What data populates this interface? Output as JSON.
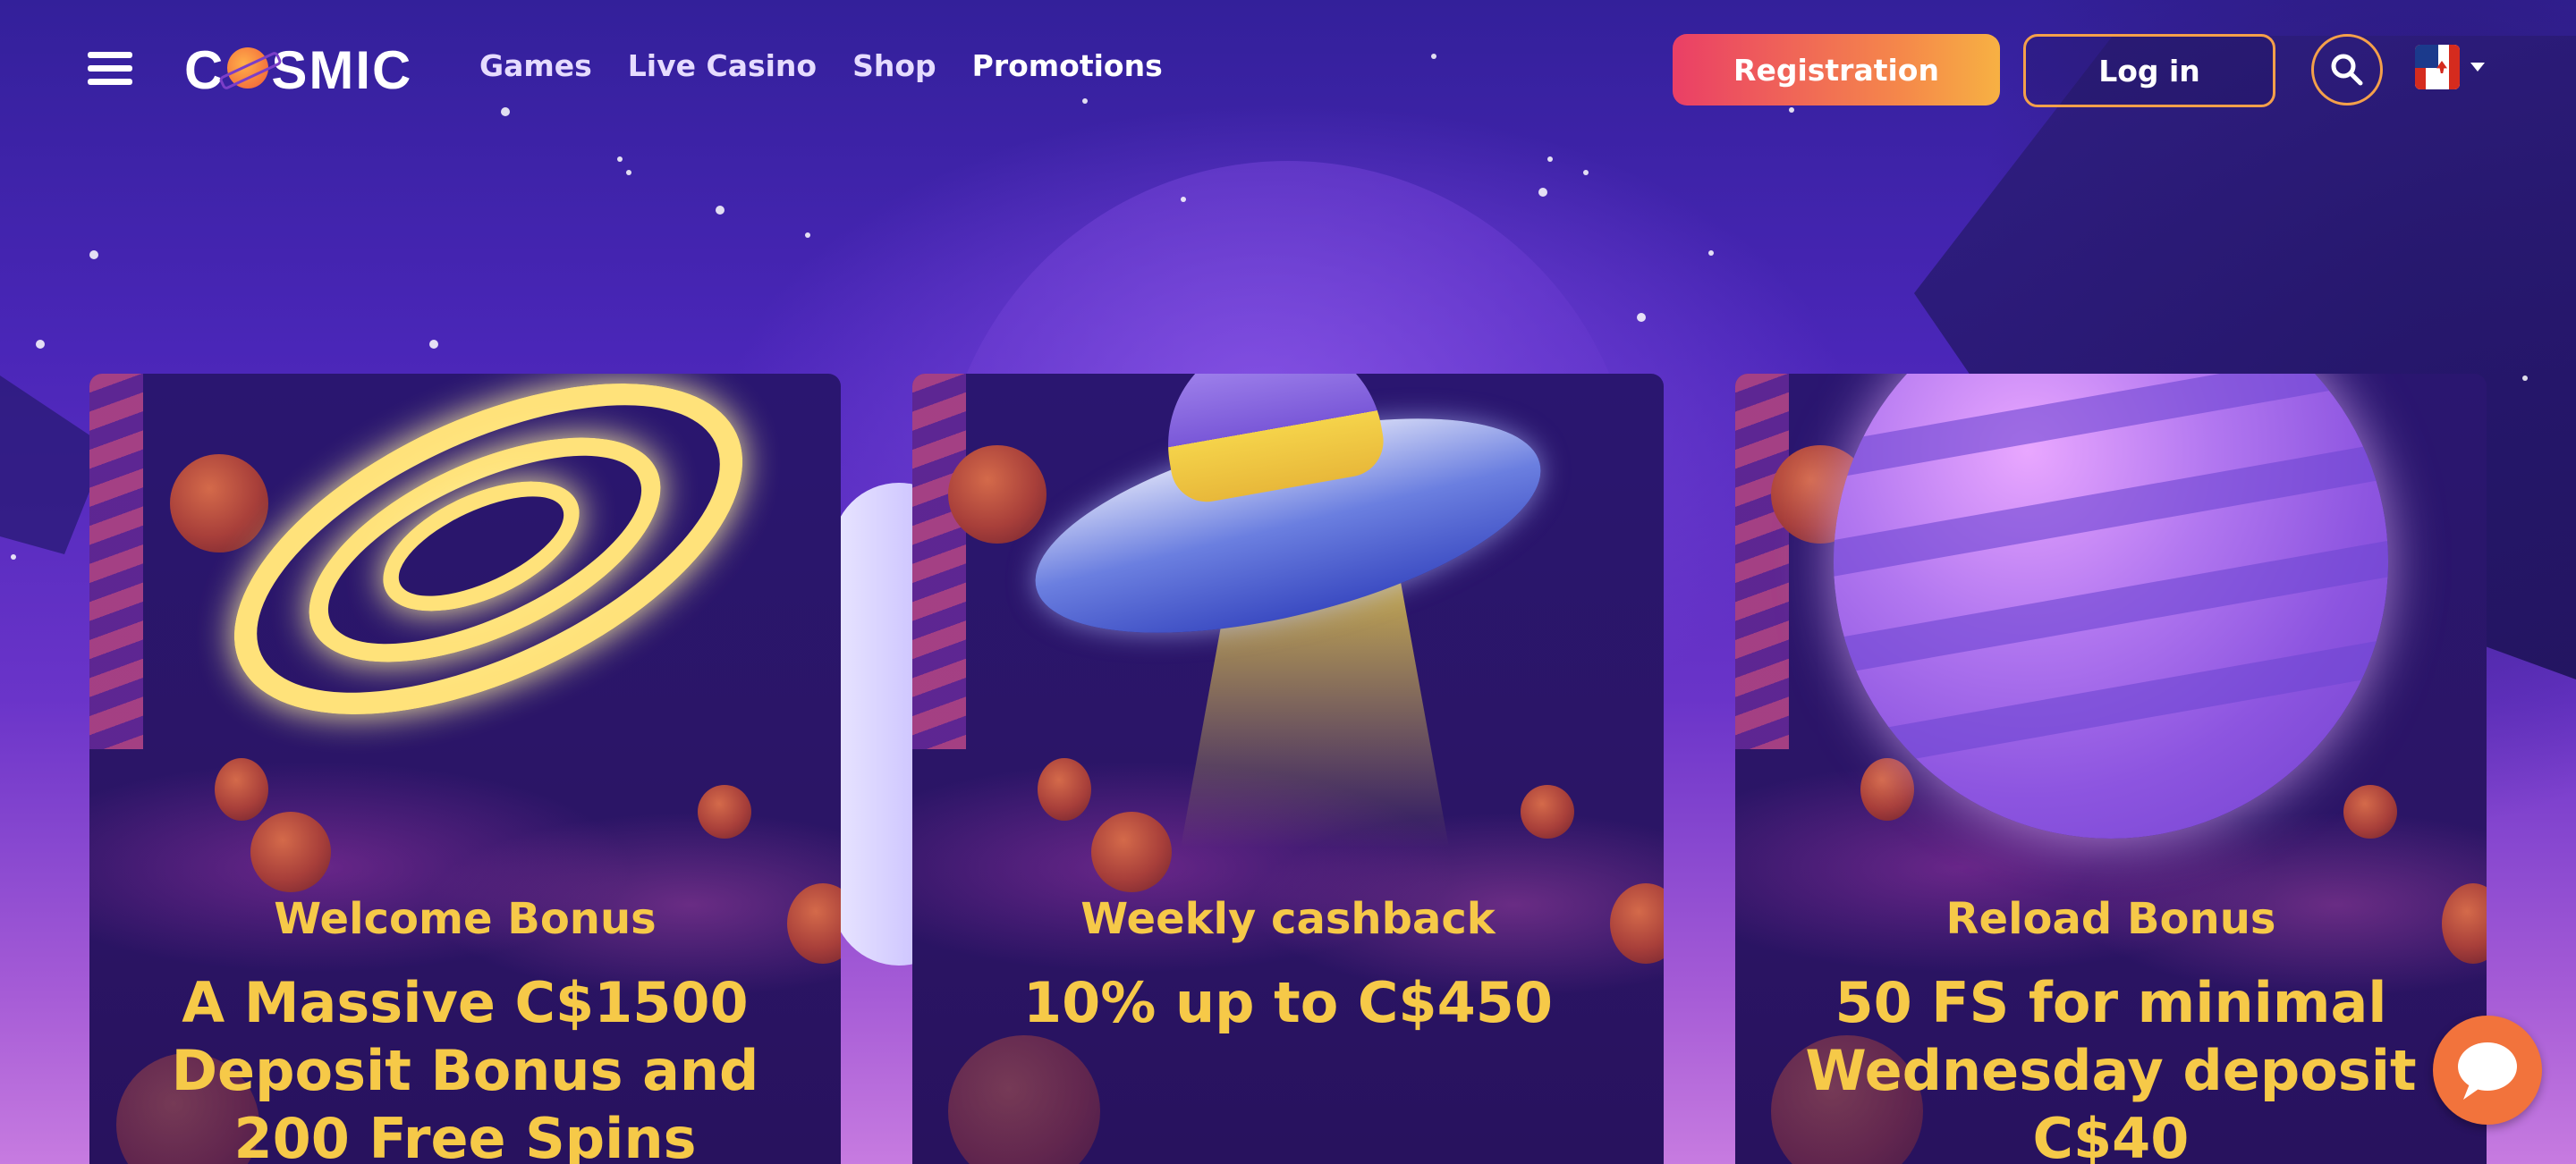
{
  "header": {
    "logo_text": "COSMIC",
    "nav": [
      {
        "label": "Games"
      },
      {
        "label": "Live Casino"
      },
      {
        "label": "Shop"
      },
      {
        "label": "Promotions"
      }
    ],
    "register_label": "Registration",
    "login_label": "Log in",
    "language_icon": "canada-flag-icon"
  },
  "promotions": [
    {
      "label": "Welcome Bonus",
      "headline": "A Massive C$1500 Deposit Bonus and 200 Free Spins",
      "art": "galaxy"
    },
    {
      "label": "Weekly cashback",
      "headline": "10% up to C$450",
      "art": "ufo"
    },
    {
      "label": "Reload Bonus",
      "headline": "50 FS for minimal Wednesday deposit C$40",
      "art": "planet"
    }
  ],
  "colors": {
    "accent_gold": "#f6c948",
    "register_gradient_start": "#ea3f66",
    "register_gradient_end": "#f7b143",
    "chat_orange": "#f2733c"
  }
}
